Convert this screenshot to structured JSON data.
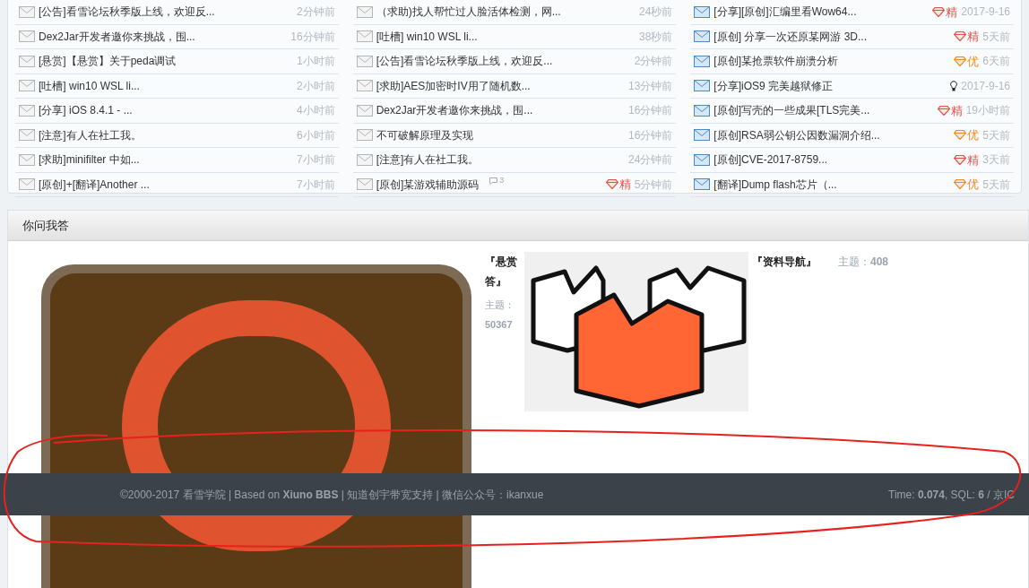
{
  "thread_columns": [
    {
      "threads": [
        {
          "title": "[公告]看雪论坛秋季版上线，欢迎反...",
          "time": "2分钟前",
          "read": true
        },
        {
          "title": "Dex2Jar开发者邀你来挑战，围...",
          "time": "16分钟前",
          "read": true
        },
        {
          "title": "[悬赏]【悬赏】关于peda调试",
          "time": "1小时前",
          "read": true
        },
        {
          "title": "[吐槽] win10 WSL li...",
          "time": "2小时前",
          "read": true
        },
        {
          "title": "[分享] iOS 8.4.1 - ...",
          "time": "4小时前",
          "read": true
        },
        {
          "title": "[注意]有人在社工我。",
          "time": "6小时前",
          "read": true
        },
        {
          "title": "[求助]minifilter 中如...",
          "time": "7小时前",
          "read": true
        },
        {
          "title": "[原创]+[翻译]Another ...",
          "time": "7小时前",
          "read": true
        }
      ]
    },
    {
      "threads": [
        {
          "title": "（求助)找人帮忙过人脸活体检测，网...",
          "time": "24秒前",
          "read": true
        },
        {
          "title": "[吐槽] win10 WSL li...",
          "time": "38秒前",
          "read": true
        },
        {
          "title": "[公告]看雪论坛秋季版上线，欢迎反...",
          "time": "2分钟前",
          "read": true
        },
        {
          "title": "[求助]AES加密时IV用了随机数...",
          "time": "13分钟前",
          "read": true
        },
        {
          "title": "Dex2Jar开发者邀你来挑战，围...",
          "time": "16分钟前",
          "read": true
        },
        {
          "title": "不可破解原理及实现",
          "time": "16分钟前",
          "read": true
        },
        {
          "title": "[注意]有人在社工我。",
          "time": "24分钟前",
          "read": true
        },
        {
          "title": "[原创]某游戏辅助源码",
          "reply_count": "3",
          "badge": {
            "kind": "jing",
            "label": "精"
          },
          "time": "5分钟前",
          "read": true
        }
      ]
    },
    {
      "threads": [
        {
          "title": "[分享][原创]汇编里看Wow64...",
          "badge": {
            "kind": "jing",
            "label": "精"
          },
          "time": "2017-9-16",
          "read": false
        },
        {
          "title": "[原创] 分享一次还原某网游 3D...",
          "badge": {
            "kind": "jing",
            "label": "精"
          },
          "time": "5天前",
          "read": false
        },
        {
          "title": "[原创]某抢票软件崩溃分析",
          "badge": {
            "kind": "you",
            "label": "优"
          },
          "time": "6天前",
          "read": false
        },
        {
          "title": "[分享]iOS9 完美越狱修正",
          "badge": {
            "kind": "bulb"
          },
          "time": "2017-9-16",
          "read": false
        },
        {
          "title": "[原创]写壳的一些成果[TLS完美...",
          "badge": {
            "kind": "jing",
            "label": "精"
          },
          "time": "19小时前",
          "read": false
        },
        {
          "title": "[原创]RSA弱公钥公因数漏洞介绍...",
          "badge": {
            "kind": "you",
            "label": "优"
          },
          "time": "5天前",
          "read": false
        },
        {
          "title": "[原创]CVE-2017-8759...",
          "badge": {
            "kind": "jing",
            "label": "精"
          },
          "time": "3天前",
          "read": false
        },
        {
          "title": "[翻译]Dump flash芯片（...",
          "badge": {
            "kind": "you",
            "label": "优"
          },
          "time": "5天前",
          "read": false
        }
      ]
    }
  ],
  "qa_section": {
    "title": "你问我答",
    "forums": [
      {
        "name": "『悬赏答』",
        "topics_label": "主题：",
        "topics": "50367"
      },
      {
        "name": "『资料导航』",
        "topics_label": "主题：",
        "topics": "408"
      }
    ]
  },
  "footer": {
    "left": "©2000-2017 看雪学院 | Based on **Xiuno BBS** | 知道创宇带宽支持 | 微信公众号：ikanxue",
    "right": "Time: **0.074**, SQL: **6** / 京IC"
  }
}
